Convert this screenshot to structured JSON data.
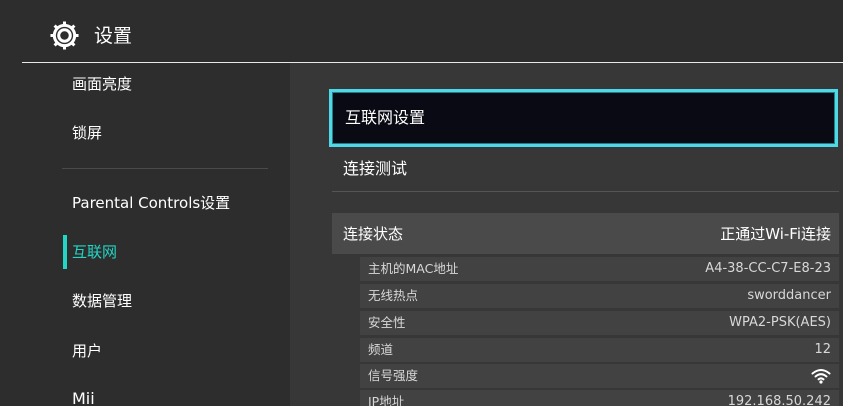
{
  "header": {
    "title": "设置",
    "icon": "gear-icon"
  },
  "sidebar": {
    "items": [
      {
        "label": "画面亮度"
      },
      {
        "label": "锁屏"
      },
      {
        "label": "Parental Controls设置"
      },
      {
        "label": "互联网",
        "active": true
      },
      {
        "label": "数据管理"
      },
      {
        "label": "用户"
      },
      {
        "label": "Mii"
      }
    ]
  },
  "main": {
    "internet_settings_label": "互联网设置",
    "connection_test_label": "连接测试",
    "status": {
      "label": "连接状态",
      "value": "正通过Wi-Fi连接"
    },
    "details": [
      {
        "label": "主机的MAC地址",
        "value": "A4-38-CC-C7-E8-23"
      },
      {
        "label": "无线热点",
        "value": "sworddancer"
      },
      {
        "label": "安全性",
        "value": "WPA2-PSK(AES)"
      },
      {
        "label": "频道",
        "value": "12"
      },
      {
        "label": "信号强度",
        "value": "",
        "icon": "wifi-signal-icon"
      },
      {
        "label": "IP地址",
        "value": "192.168.50.242"
      }
    ]
  },
  "colors": {
    "accent": "#23d5c5",
    "focus_border": "#4fd8e6",
    "background": "#2d2d2d",
    "panel": "#373737"
  }
}
